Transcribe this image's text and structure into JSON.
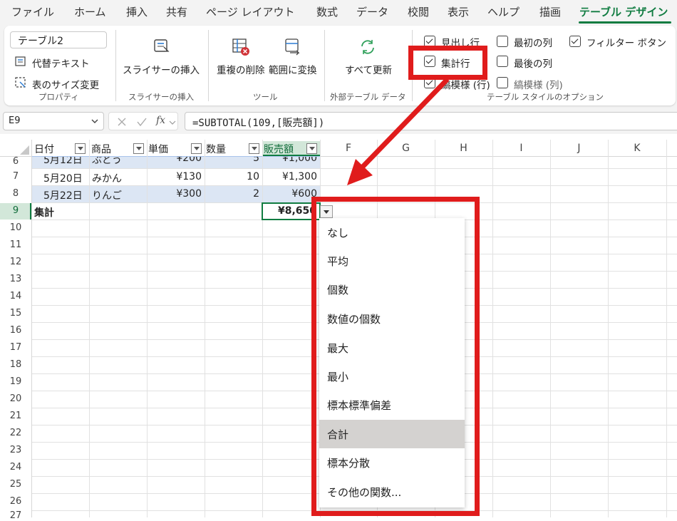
{
  "ribbon_tabs": [
    "ファイル",
    "ホーム",
    "挿入",
    "共有",
    "ページ レイアウト",
    "数式",
    "データ",
    "校閲",
    "表示",
    "ヘルプ",
    "描画",
    "テーブル デザイン"
  ],
  "properties": {
    "table_name": "テーブル2",
    "alt_text": "代替テキスト",
    "resize": "表のサイズ変更",
    "label": "プロパティ"
  },
  "slicer": {
    "insert": "スライサーの挿入",
    "label": "スライサーの挿入"
  },
  "tools": {
    "remove_dup": "重複の削除",
    "convert": "範囲に変換",
    "label": "ツール"
  },
  "external": {
    "refresh": "すべて更新",
    "label": "外部テーブル データ"
  },
  "style_options": {
    "header_row": "見出し行",
    "total_row": "集計行",
    "banded_rows": "縞模様 (行)",
    "first_column": "最初の列",
    "last_column": "最後の列",
    "banded_columns": "縞模様 (列)",
    "filter_button": "フィルター ボタン",
    "label": "テーブル スタイルのオプション"
  },
  "name_box": "E9",
  "formula": "=SUBTOTAL(109,[販売額])",
  "fx_label": "fx",
  "columns": [
    "F",
    "G",
    "H",
    "I",
    "J",
    "K"
  ],
  "table_headers": [
    "日付",
    "商品",
    "単価",
    "数量",
    "販売額"
  ],
  "rows": [
    {
      "num": "6",
      "date": "5月12日",
      "product": "ぶどう",
      "price": "¥200",
      "qty": "5",
      "sales": "¥1,000"
    },
    {
      "num": "7",
      "date": "5月20日",
      "product": "みかん",
      "price": "¥130",
      "qty": "10",
      "sales": "¥1,300"
    },
    {
      "num": "8",
      "date": "5月22日",
      "product": "りんご",
      "price": "¥300",
      "qty": "2",
      "sales": "¥600"
    }
  ],
  "total_row": {
    "num": "9",
    "label": "集計",
    "value": "¥8,650"
  },
  "empty_rows": [
    "10",
    "11",
    "12",
    "13",
    "14",
    "15",
    "16",
    "17",
    "18",
    "19",
    "20",
    "21",
    "22",
    "23",
    "24",
    "25",
    "26",
    "27"
  ],
  "dropdown_items": [
    "なし",
    "平均",
    "個数",
    "数値の個数",
    "最大",
    "最小",
    "標本標準偏差",
    "合計",
    "標本分散",
    "その他の関数..."
  ],
  "selected_item": "合計",
  "colors": {
    "accent": "#107c41",
    "annotation_red": "#e01c1c",
    "table_band": "#dce6f4",
    "selected": "#d4d2d0"
  }
}
